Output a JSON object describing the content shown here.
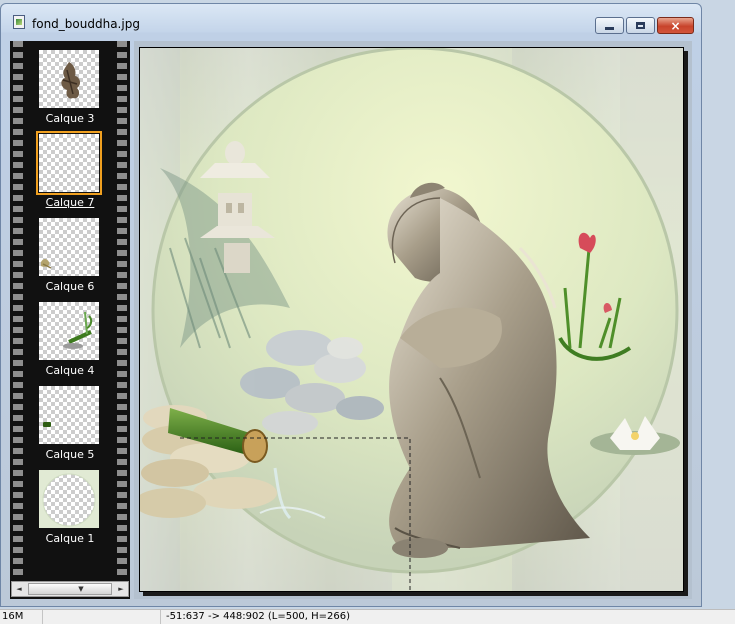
{
  "window": {
    "title": "fond_bouddha.jpg",
    "buttons": {
      "minimize": "minimize",
      "maximize": "maximize",
      "close": "×"
    }
  },
  "layers": [
    {
      "label": "Calque 3",
      "icon": "tree-figure-thumbnail"
    },
    {
      "label": "Calque 7",
      "icon": "empty-thumbnail",
      "selected": true
    },
    {
      "label": "Calque 6",
      "icon": "small-figure-thumbnail"
    },
    {
      "label": "Calque 4",
      "icon": "bamboo-thumbnail"
    },
    {
      "label": "Calque 5",
      "icon": "leaf-thumbnail"
    },
    {
      "label": "Calque 1",
      "icon": "circle-thumbnail"
    }
  ],
  "strip_scroll": {
    "left": "◄",
    "down": "▼",
    "right": "►"
  },
  "status": {
    "memory": "16M",
    "coords": "-51:637 -> 448:902 (L=500, H=266)"
  },
  "colors": {
    "selection_outline": "#f0a020",
    "filmstrip_bg": "#111111",
    "close_button": "#c8442c"
  }
}
